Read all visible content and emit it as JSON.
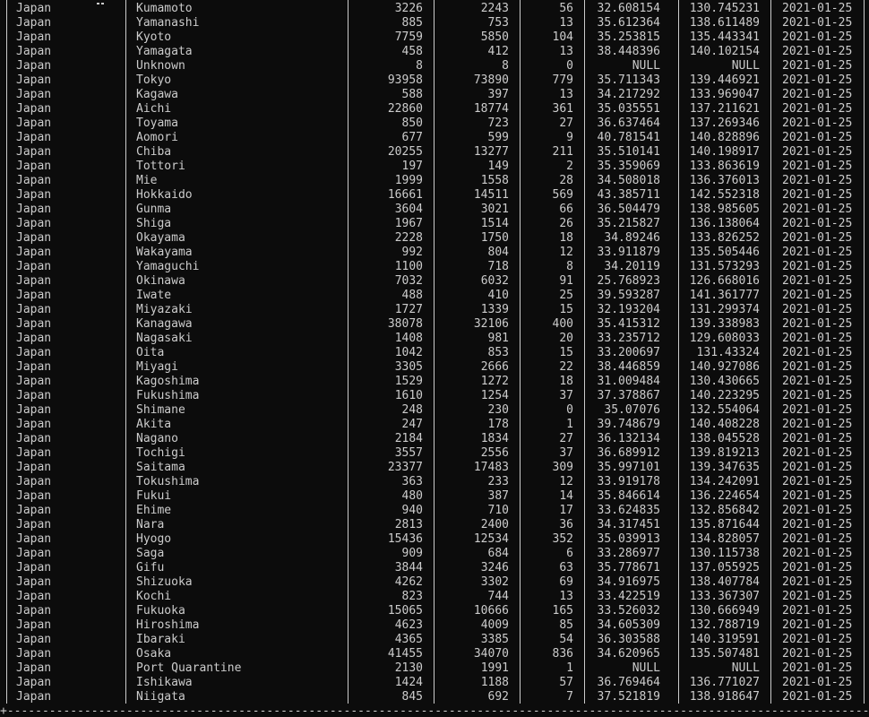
{
  "window": {
    "bottom_border": "+--------------------------------------------------------------------------------------------------------------------------------------------------+"
  },
  "table": {
    "rows": [
      [
        "Japan",
        "Kumamoto",
        "3226",
        "2243",
        "56",
        "32.608154",
        "130.745231",
        "2021-01-25"
      ],
      [
        "Japan",
        "Yamanashi",
        "885",
        "753",
        "13",
        "35.612364",
        "138.611489",
        "2021-01-25"
      ],
      [
        "Japan",
        "Kyoto",
        "7759",
        "5850",
        "104",
        "35.253815",
        "135.443341",
        "2021-01-25"
      ],
      [
        "Japan",
        "Yamagata",
        "458",
        "412",
        "13",
        "38.448396",
        "140.102154",
        "2021-01-25"
      ],
      [
        "Japan",
        "Unknown",
        "8",
        "8",
        "0",
        "NULL",
        "NULL",
        "2021-01-25"
      ],
      [
        "Japan",
        "Tokyo",
        "93958",
        "73890",
        "779",
        "35.711343",
        "139.446921",
        "2021-01-25"
      ],
      [
        "Japan",
        "Kagawa",
        "588",
        "397",
        "13",
        "34.217292",
        "133.969047",
        "2021-01-25"
      ],
      [
        "Japan",
        "Aichi",
        "22860",
        "18774",
        "361",
        "35.035551",
        "137.211621",
        "2021-01-25"
      ],
      [
        "Japan",
        "Toyama",
        "850",
        "723",
        "27",
        "36.637464",
        "137.269346",
        "2021-01-25"
      ],
      [
        "Japan",
        "Aomori",
        "677",
        "599",
        "9",
        "40.781541",
        "140.828896",
        "2021-01-25"
      ],
      [
        "Japan",
        "Chiba",
        "20255",
        "13277",
        "211",
        "35.510141",
        "140.198917",
        "2021-01-25"
      ],
      [
        "Japan",
        "Tottori",
        "197",
        "149",
        "2",
        "35.359069",
        "133.863619",
        "2021-01-25"
      ],
      [
        "Japan",
        "Mie",
        "1999",
        "1558",
        "28",
        "34.508018",
        "136.376013",
        "2021-01-25"
      ],
      [
        "Japan",
        "Hokkaido",
        "16661",
        "14511",
        "569",
        "43.385711",
        "142.552318",
        "2021-01-25"
      ],
      [
        "Japan",
        "Gunma",
        "3604",
        "3021",
        "66",
        "36.504479",
        "138.985605",
        "2021-01-25"
      ],
      [
        "Japan",
        "Shiga",
        "1967",
        "1514",
        "26",
        "35.215827",
        "136.138064",
        "2021-01-25"
      ],
      [
        "Japan",
        "Okayama",
        "2228",
        "1750",
        "18",
        "34.89246",
        "133.826252",
        "2021-01-25"
      ],
      [
        "Japan",
        "Wakayama",
        "992",
        "804",
        "12",
        "33.911879",
        "135.505446",
        "2021-01-25"
      ],
      [
        "Japan",
        "Yamaguchi",
        "1100",
        "718",
        "8",
        "34.20119",
        "131.573293",
        "2021-01-25"
      ],
      [
        "Japan",
        "Okinawa",
        "7032",
        "6032",
        "91",
        "25.768923",
        "126.668016",
        "2021-01-25"
      ],
      [
        "Japan",
        "Iwate",
        "488",
        "410",
        "25",
        "39.593287",
        "141.361777",
        "2021-01-25"
      ],
      [
        "Japan",
        "Miyazaki",
        "1727",
        "1339",
        "15",
        "32.193204",
        "131.299374",
        "2021-01-25"
      ],
      [
        "Japan",
        "Kanagawa",
        "38078",
        "32106",
        "400",
        "35.415312",
        "139.338983",
        "2021-01-25"
      ],
      [
        "Japan",
        "Nagasaki",
        "1408",
        "981",
        "20",
        "33.235712",
        "129.608033",
        "2021-01-25"
      ],
      [
        "Japan",
        "Oita",
        "1042",
        "853",
        "15",
        "33.200697",
        "131.43324",
        "2021-01-25"
      ],
      [
        "Japan",
        "Miyagi",
        "3305",
        "2666",
        "22",
        "38.446859",
        "140.927086",
        "2021-01-25"
      ],
      [
        "Japan",
        "Kagoshima",
        "1529",
        "1272",
        "18",
        "31.009484",
        "130.430665",
        "2021-01-25"
      ],
      [
        "Japan",
        "Fukushima",
        "1610",
        "1254",
        "37",
        "37.378867",
        "140.223295",
        "2021-01-25"
      ],
      [
        "Japan",
        "Shimane",
        "248",
        "230",
        "0",
        "35.07076",
        "132.554064",
        "2021-01-25"
      ],
      [
        "Japan",
        "Akita",
        "247",
        "178",
        "1",
        "39.748679",
        "140.408228",
        "2021-01-25"
      ],
      [
        "Japan",
        "Nagano",
        "2184",
        "1834",
        "27",
        "36.132134",
        "138.045528",
        "2021-01-25"
      ],
      [
        "Japan",
        "Tochigi",
        "3557",
        "2556",
        "37",
        "36.689912",
        "139.819213",
        "2021-01-25"
      ],
      [
        "Japan",
        "Saitama",
        "23377",
        "17483",
        "309",
        "35.997101",
        "139.347635",
        "2021-01-25"
      ],
      [
        "Japan",
        "Tokushima",
        "363",
        "233",
        "12",
        "33.919178",
        "134.242091",
        "2021-01-25"
      ],
      [
        "Japan",
        "Fukui",
        "480",
        "387",
        "14",
        "35.846614",
        "136.224654",
        "2021-01-25"
      ],
      [
        "Japan",
        "Ehime",
        "940",
        "710",
        "17",
        "33.624835",
        "132.856842",
        "2021-01-25"
      ],
      [
        "Japan",
        "Nara",
        "2813",
        "2400",
        "36",
        "34.317451",
        "135.871644",
        "2021-01-25"
      ],
      [
        "Japan",
        "Hyogo",
        "15436",
        "12534",
        "352",
        "35.039913",
        "134.828057",
        "2021-01-25"
      ],
      [
        "Japan",
        "Saga",
        "909",
        "684",
        "6",
        "33.286977",
        "130.115738",
        "2021-01-25"
      ],
      [
        "Japan",
        "Gifu",
        "3844",
        "3246",
        "63",
        "35.778671",
        "137.055925",
        "2021-01-25"
      ],
      [
        "Japan",
        "Shizuoka",
        "4262",
        "3302",
        "69",
        "34.916975",
        "138.407784",
        "2021-01-25"
      ],
      [
        "Japan",
        "Kochi",
        "823",
        "744",
        "13",
        "33.422519",
        "133.367307",
        "2021-01-25"
      ],
      [
        "Japan",
        "Fukuoka",
        "15065",
        "10666",
        "165",
        "33.526032",
        "130.666949",
        "2021-01-25"
      ],
      [
        "Japan",
        "Hiroshima",
        "4623",
        "4009",
        "85",
        "34.605309",
        "132.788719",
        "2021-01-25"
      ],
      [
        "Japan",
        "Ibaraki",
        "4365",
        "3385",
        "54",
        "36.303588",
        "140.319591",
        "2021-01-25"
      ],
      [
        "Japan",
        "Osaka",
        "41455",
        "34070",
        "836",
        "34.620965",
        "135.507481",
        "2021-01-25"
      ],
      [
        "Japan",
        "Port Quarantine",
        "2130",
        "1991",
        "1",
        "NULL",
        "NULL",
        "2021-01-25"
      ],
      [
        "Japan",
        "Ishikawa",
        "1424",
        "1188",
        "57",
        "36.769464",
        "136.771027",
        "2021-01-25"
      ],
      [
        "Japan",
        "Niigata",
        "845",
        "692",
        "7",
        "37.521819",
        "138.918647",
        "2021-01-25"
      ]
    ]
  }
}
